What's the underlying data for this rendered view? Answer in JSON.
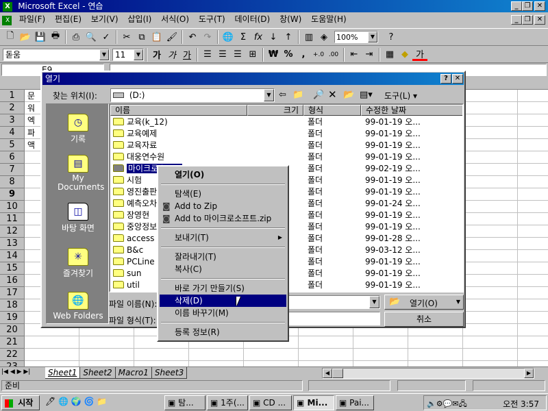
{
  "app": {
    "title": "Microsoft Excel - 연습",
    "menus": [
      "파일(F)",
      "편집(E)",
      "보기(V)",
      "삽입(I)",
      "서식(O)",
      "도구(T)",
      "데이터(D)",
      "창(W)",
      "도움말(H)"
    ],
    "zoom": "100%",
    "font_name": "돋움",
    "font_size": "11",
    "namebox": "E9",
    "row_numbers": [
      "1",
      "2",
      "3",
      "4",
      "5",
      "6",
      "7",
      "8",
      "9",
      "10",
      "11",
      "12",
      "13",
      "14",
      "15",
      "16",
      "17",
      "18",
      "19",
      "20",
      "21",
      "22",
      "23"
    ],
    "cell_texts": [
      "문",
      "워",
      "엑",
      "파",
      "액"
    ],
    "sheet_tabs": [
      "Sheet1",
      "Sheet2",
      "Macro1",
      "Sheet3"
    ],
    "status": "준비"
  },
  "toolbar_format": {
    "bold": "가",
    "italic": "가",
    "underline": "가",
    "currency": "₩",
    "percent": "%",
    "comma": ",",
    "font_color_glyph": "가"
  },
  "dialog": {
    "title": "열기",
    "lookin_label": "찾는 위치(I):",
    "lookin_value": "(D:)",
    "tools_label": "도구(L) ▾",
    "columns": {
      "name": "이름",
      "size": "크기",
      "type": "형식",
      "modified": "수정한 날짜"
    },
    "files": [
      {
        "name": "교육(k_12)",
        "type": "폴더",
        "date": "99-01-19 오..."
      },
      {
        "name": "교육예제",
        "type": "폴더",
        "date": "99-01-19 오..."
      },
      {
        "name": "교육자료",
        "type": "폴더",
        "date": "99-01-19 오..."
      },
      {
        "name": "대웅연수원",
        "type": "폴더",
        "date": "99-01-19 오..."
      },
      {
        "name": "마이크로소프트",
        "type": "폴더",
        "date": "99-02-19 오..."
      },
      {
        "name": "시험",
        "type": "폴더",
        "date": "99-01-19 오..."
      },
      {
        "name": "영진출판",
        "type": "폴더",
        "date": "99-01-19 오..."
      },
      {
        "name": "예측오차",
        "type": "폴더",
        "date": "99-01-24 오..."
      },
      {
        "name": "장영현",
        "type": "폴더",
        "date": "99-01-19 오..."
      },
      {
        "name": "중앙정보",
        "type": "폴더",
        "date": "99-01-19 오..."
      },
      {
        "name": "access",
        "type": "폴더",
        "date": "99-01-28 오..."
      },
      {
        "name": "B&c",
        "type": "폴더",
        "date": "99-03-12 오..."
      },
      {
        "name": "PCLine",
        "type": "폴더",
        "date": "99-01-19 오..."
      },
      {
        "name": "sun",
        "type": "폴더",
        "date": "99-01-19 오..."
      },
      {
        "name": "util",
        "type": "폴더",
        "date": "99-01-19 오..."
      }
    ],
    "places": [
      {
        "label": "기록",
        "icon": "history-icon"
      },
      {
        "label": "My Documents",
        "icon": "my-documents-icon"
      },
      {
        "label": "바탕 화면",
        "icon": "desktop-icon"
      },
      {
        "label": "즐겨찾기",
        "icon": "favorites-icon"
      },
      {
        "label": "Web Folders",
        "icon": "web-folders-icon"
      }
    ],
    "filename_label": "파일 이름(N):",
    "filetype_label": "파일 형식(T):",
    "open_button": "열기(O)",
    "cancel_button": "취소"
  },
  "context_menu": {
    "items": [
      {
        "label": "열기(O)",
        "bold": true
      },
      {
        "sep": true
      },
      {
        "label": "탐색(E)"
      },
      {
        "label": "Add to Zip",
        "icon": true
      },
      {
        "label": "Add to 마이크로소프트.zip",
        "icon": true
      },
      {
        "sep": true
      },
      {
        "label": "보내기(T)",
        "submenu": true
      },
      {
        "sep": true
      },
      {
        "label": "잘라내기(T)"
      },
      {
        "label": "복사(C)"
      },
      {
        "sep": true
      },
      {
        "label": "바로 가기 만들기(S)"
      },
      {
        "label": "삭제(D)",
        "selected": true
      },
      {
        "label": "이름 바꾸기(M)"
      },
      {
        "sep": true
      },
      {
        "label": "등록 정보(R)"
      }
    ]
  },
  "taskbar": {
    "start": "시작",
    "tasks": [
      "탐...",
      "1주(...",
      "CD ...",
      "Mi...",
      "Pai..."
    ],
    "clock": "오전 3:57"
  },
  "colors": {
    "title_active": "#000080",
    "selection": "#000080",
    "face": "#c0c0c0",
    "places_bg": "#808080",
    "folder": "#ffff80"
  }
}
